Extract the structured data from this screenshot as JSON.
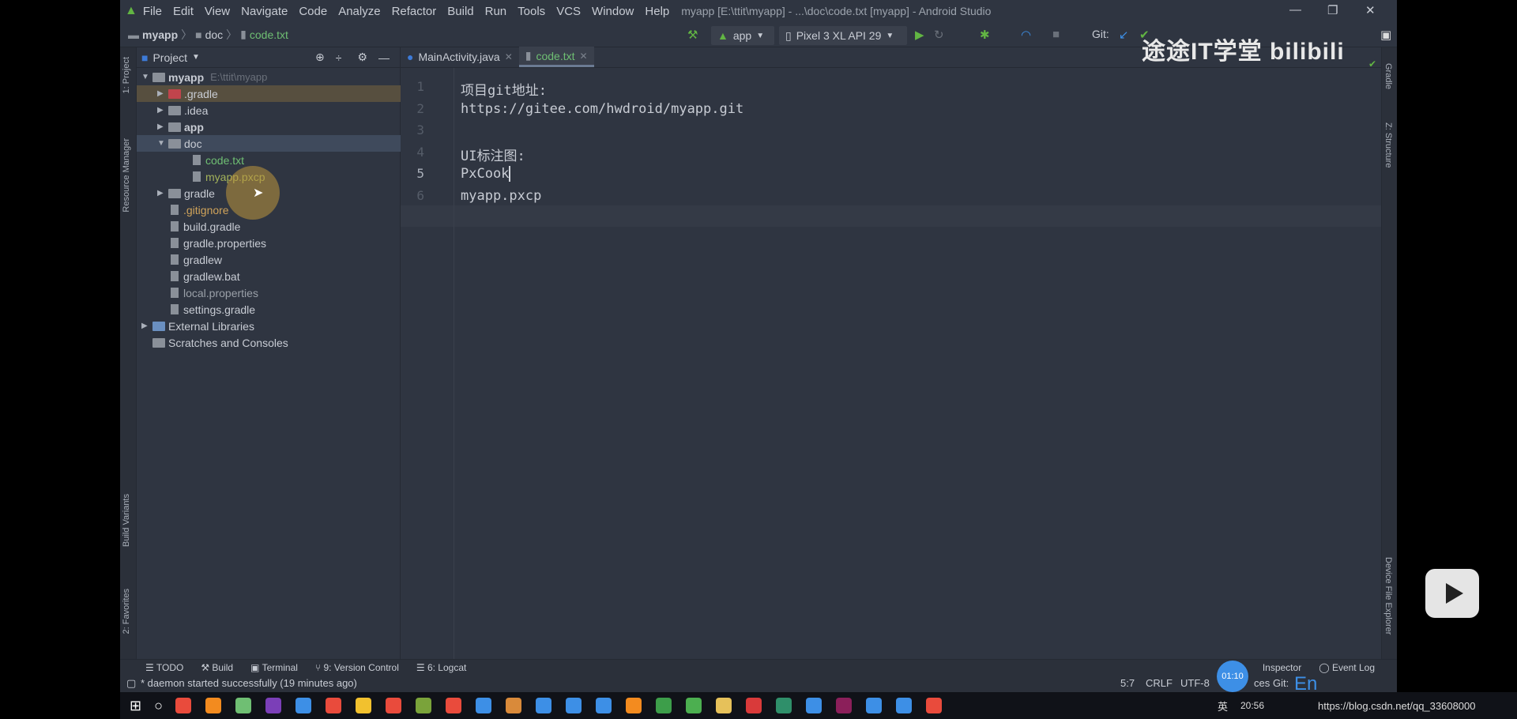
{
  "menu": [
    "File",
    "Edit",
    "View",
    "Navigate",
    "Code",
    "Analyze",
    "Refactor",
    "Build",
    "Run",
    "Tools",
    "VCS",
    "Window",
    "Help"
  ],
  "window_title": "myapp [E:\\ttit\\myapp] - ...\\doc\\code.txt [myapp] - Android Studio",
  "breadcrumb": [
    "myapp",
    "doc",
    "code.txt"
  ],
  "toolbar": {
    "run_config": "app",
    "device": "Pixel 3 XL API 29",
    "git_label": "Git:"
  },
  "left_stripe": [
    "1: Project",
    "Resource Manager",
    "Build Variants",
    "2: Favorites"
  ],
  "right_stripe": [
    "Gradle",
    "Z: Structure",
    "Device File Explorer"
  ],
  "project_panel": {
    "title": "Project",
    "tree": [
      {
        "label": "myapp",
        "extra": "E:\\ttit\\myapp",
        "depth": 0,
        "arrow": "down",
        "bold": true
      },
      {
        "label": ".gradle",
        "depth": 1,
        "arrow": "right",
        "type": "folder-red",
        "selected": "hover"
      },
      {
        "label": ".idea",
        "depth": 1,
        "arrow": "right",
        "type": "folder"
      },
      {
        "label": "app",
        "depth": 1,
        "arrow": "right",
        "type": "folder",
        "bold": true
      },
      {
        "label": "doc",
        "depth": 1,
        "arrow": "down",
        "type": "folder",
        "selected": "active"
      },
      {
        "label": "code.txt",
        "depth": 2,
        "type": "file",
        "color": "#6fbf73"
      },
      {
        "label": "myapp.pxcp",
        "depth": 2,
        "type": "file",
        "color": "#a3b25a"
      },
      {
        "label": "gradle",
        "depth": 1,
        "arrow": "right",
        "type": "folder"
      },
      {
        "label": ".gitignore",
        "depth": 1,
        "type": "file",
        "color": "#d0a35a"
      },
      {
        "label": "build.gradle",
        "depth": 1,
        "type": "file"
      },
      {
        "label": "gradle.properties",
        "depth": 1,
        "type": "file"
      },
      {
        "label": "gradlew",
        "depth": 1,
        "type": "file"
      },
      {
        "label": "gradlew.bat",
        "depth": 1,
        "type": "file"
      },
      {
        "label": "local.properties",
        "depth": 1,
        "type": "file",
        "color": "#9aa0a8"
      },
      {
        "label": "settings.gradle",
        "depth": 1,
        "type": "file"
      },
      {
        "label": "External Libraries",
        "depth": 0,
        "arrow": "right",
        "type": "lib"
      },
      {
        "label": "Scratches and Consoles",
        "depth": 0,
        "type": "scratch"
      }
    ]
  },
  "editor": {
    "tabs": [
      {
        "label": "MainActivity.java",
        "active": false
      },
      {
        "label": "code.txt",
        "active": true
      }
    ],
    "lines": [
      "项目git地址:",
      "https://gitee.com/hwdroid/myapp.git",
      "",
      "UI标注图:",
      "PxCook",
      "myapp.pxcp"
    ],
    "current_line": 5
  },
  "bottom_tabs": [
    "TODO",
    "Build",
    "Terminal",
    "9: Version Control",
    "6: Logcat",
    "Inspector",
    "Event Log"
  ],
  "status": {
    "message": "* daemon started successfully (19 minutes ago)",
    "position": "5:7",
    "line_sep": "CRLF",
    "encoding": "UTF-8",
    "vcs": "ces",
    "git": "Git:"
  },
  "overlay": {
    "watermark": "途途IT学堂 bilibili",
    "timer": "01:10",
    "url": "https://blog.csdn.net/qq_33608000",
    "ime": "En"
  },
  "taskbar": {
    "time": "20:56",
    "lang": "英"
  }
}
